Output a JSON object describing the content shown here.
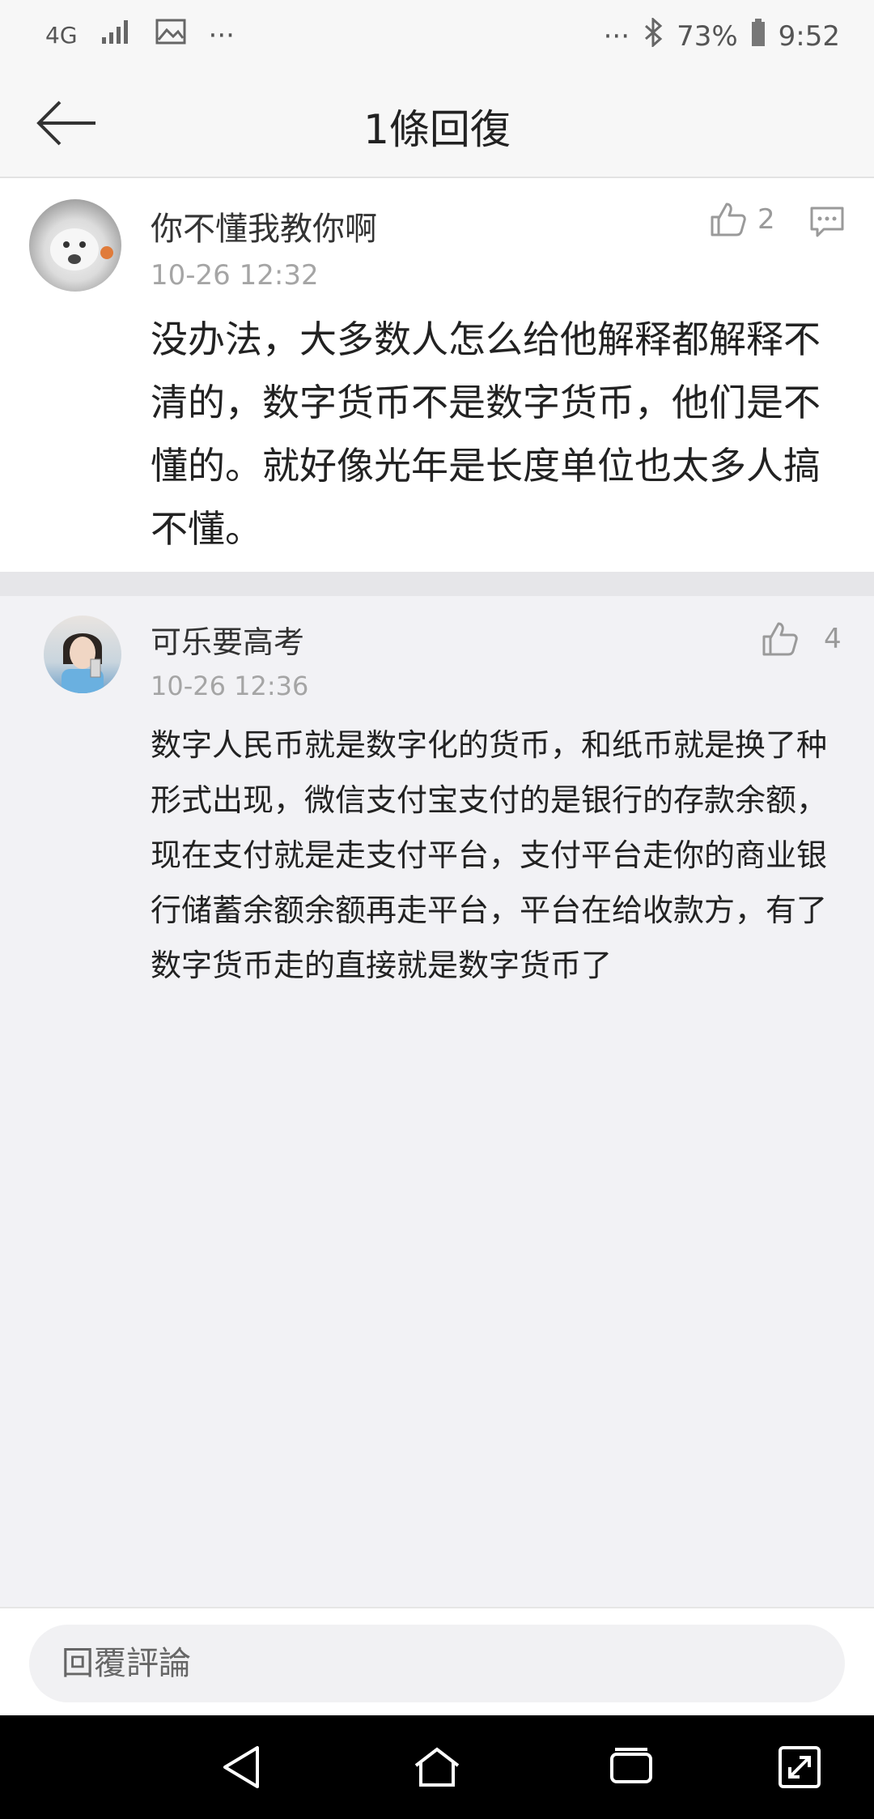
{
  "status": {
    "network": "4G",
    "more_left": "···",
    "more_right": "···",
    "battery": "73%",
    "time": "9:52"
  },
  "header": {
    "title": "1條回復"
  },
  "comment": {
    "username": "你不懂我教你啊",
    "time": "10-26 12:32",
    "likes": "2",
    "text": "没办法，大多数人怎么给他解释都解释不清的，数字货币不是数字货币，他们是不懂的。就好像光年是长度单位也太多人搞不懂。"
  },
  "reply": {
    "username": "可乐要高考",
    "time": "10-26 12:36",
    "likes": "4",
    "text": "数字人民币就是数字化的货币，和纸币就是换了种形式出现，微信支付宝支付的是银行的存款余额，现在支付就是走支付平台，支付平台走你的商业银行储蓄余额余额再走平台，平台在给收款方，有了数字货币走的直接就是数字货币了"
  },
  "input": {
    "placeholder": "回覆評論"
  }
}
